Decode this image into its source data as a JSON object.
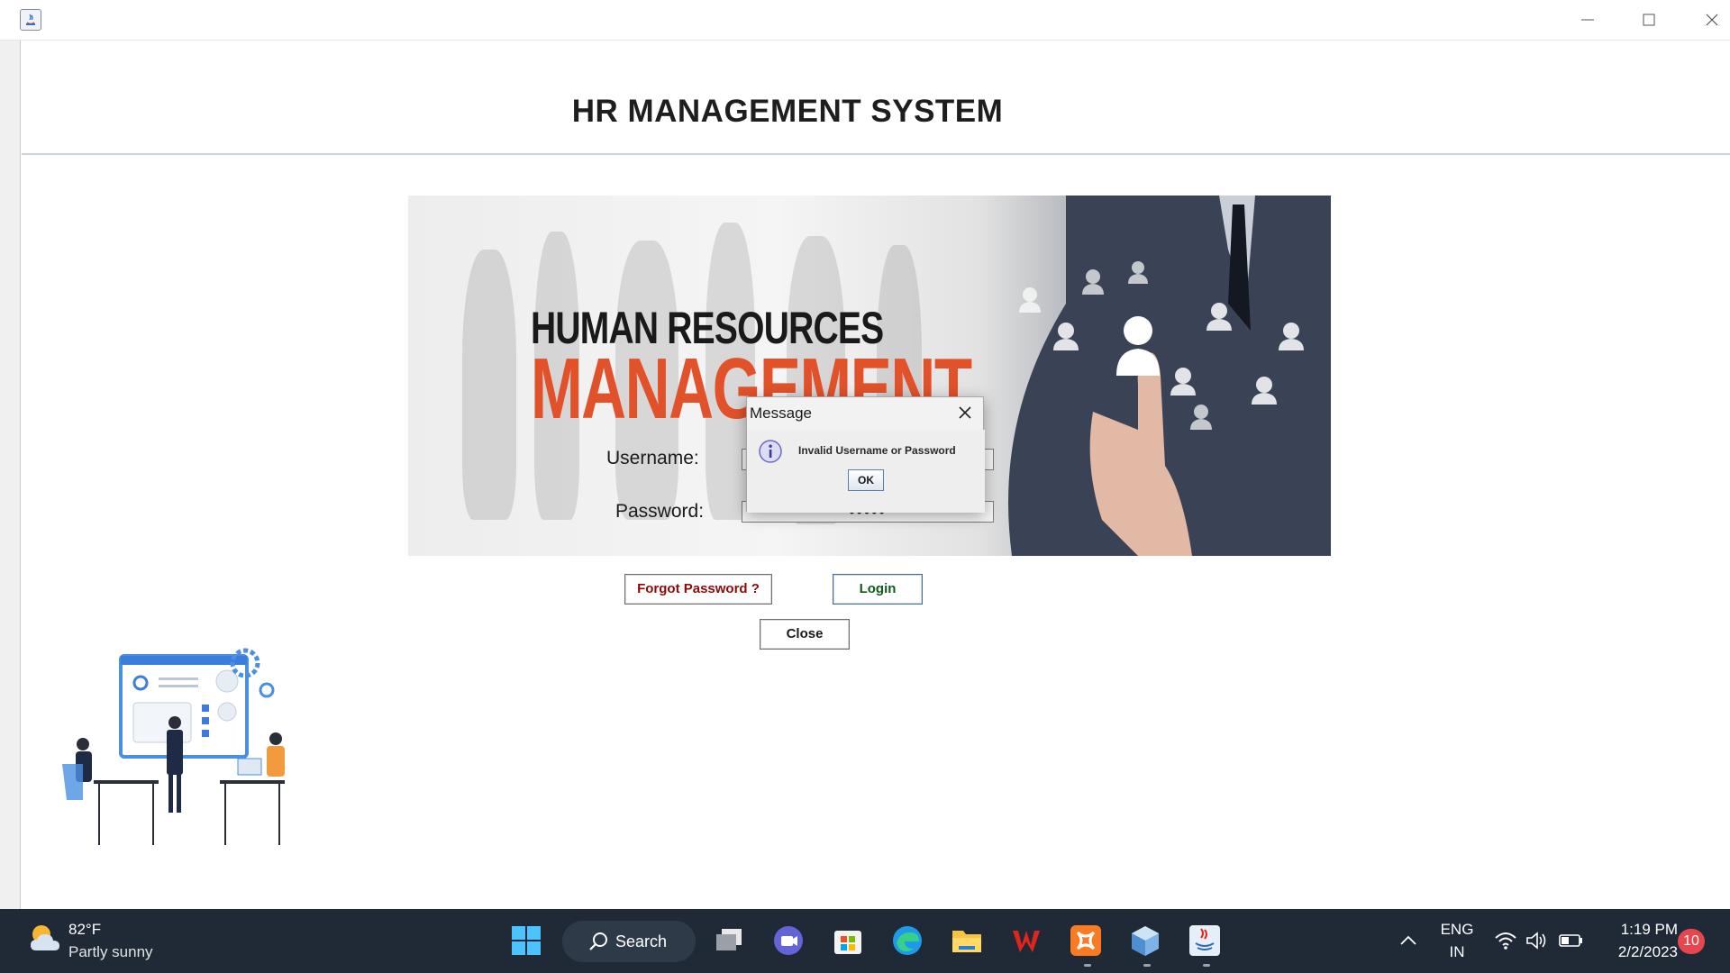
{
  "app": {
    "title": "HR MANAGEMENT SYSTEM",
    "banner_line1": "HUMAN RESOURCES",
    "banner_line2": "MANAGEMENT"
  },
  "login_form": {
    "username_label": "Username:",
    "username_value": "",
    "password_label": "Password:",
    "password_value": "•••••",
    "forgot_label": "Forgot Password ?",
    "login_label": "Login",
    "close_label": "Close"
  },
  "dialog": {
    "title": "Message",
    "message": "Invalid Username or Password",
    "ok_label": "OK"
  },
  "taskbar": {
    "weather_temp": "82°F",
    "weather_desc": "Partly sunny",
    "search_label": "Search",
    "language_top": "ENG",
    "language_bottom": "IN",
    "time": "1:19 PM",
    "date": "2/2/2023",
    "notification_count": "10"
  },
  "colors": {
    "banner_orange": "#e2522a",
    "forgot_text": "#8b0a0a",
    "login_text": "#0d5a1c",
    "taskbar_bg": "#1f2a36",
    "badge_red": "#e8464f"
  },
  "icons": [
    "java-icon",
    "minimize-icon",
    "maximize-icon",
    "close-icon",
    "info-icon",
    "weather-icon",
    "windows-start-icon",
    "search-icon",
    "task-view-icon",
    "teams-icon",
    "store-icon",
    "edge-icon",
    "file-explorer-icon",
    "wps-icon",
    "xampp-icon",
    "virtualbox-icon",
    "java-app-icon",
    "chevron-up-icon",
    "wifi-icon",
    "volume-icon",
    "battery-icon"
  ]
}
